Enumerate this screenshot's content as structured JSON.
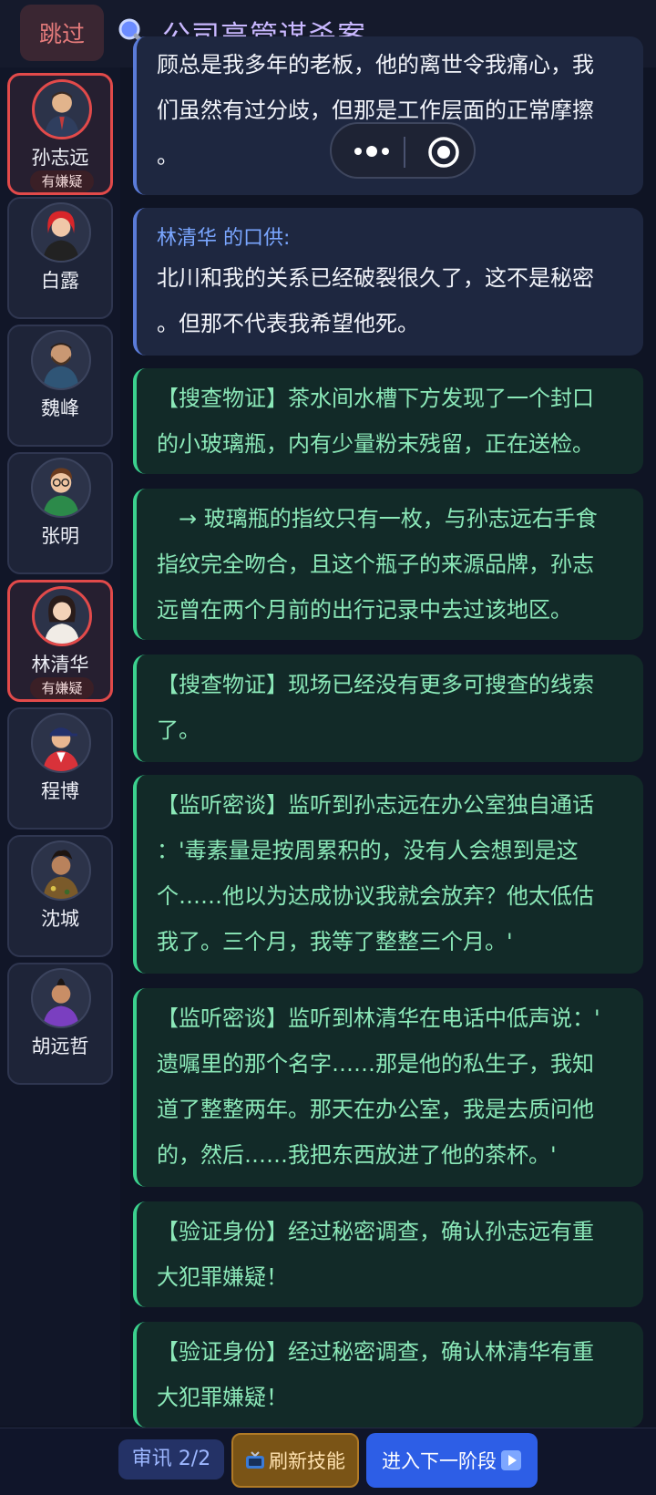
{
  "header": {
    "skip_label": "跳过",
    "title": "公司高管谋杀案"
  },
  "suspects": [
    {
      "name": "孙志远",
      "badge": "有嫌疑",
      "flagged": true
    },
    {
      "name": "白露",
      "badge": "",
      "flagged": false
    },
    {
      "name": "魏峰",
      "badge": "",
      "flagged": false
    },
    {
      "name": "张明",
      "badge": "",
      "flagged": false
    },
    {
      "name": "林清华",
      "badge": "有嫌疑",
      "flagged": true
    },
    {
      "name": "程博",
      "badge": "",
      "flagged": false
    },
    {
      "name": "沈城",
      "badge": "",
      "flagged": false
    },
    {
      "name": "胡远哲",
      "badge": "",
      "flagged": false
    }
  ],
  "messages": [
    {
      "type": "statement",
      "text": "顾总是我多年的老板，他的离世令我痛心，我\n们虽然有过分歧，但那是工作层面的正常摩擦\n。"
    },
    {
      "type": "statement",
      "speaker": "林清华 的口供:",
      "text": "北川和我的关系已经破裂很久了，这不是秘密\n。但那不代表我希望他死。"
    },
    {
      "type": "evidence",
      "text": "【搜查物证】茶水间水槽下方发现了一个封口\n的小玻璃瓶，内有少量粉末残留，正在送检。"
    },
    {
      "type": "evidence",
      "text": "　→ 玻璃瓶的指纹只有一枚，与孙志远右手食\n指纹完全吻合，且这个瓶子的来源品牌，孙志\n远曾在两个月前的出行记录中去过该地区。"
    },
    {
      "type": "evidence",
      "text": "【搜查物证】现场已经没有更多可搜查的线索\n了。"
    },
    {
      "type": "evidence",
      "text": "【监听密谈】监听到孙志远在办公室独自通话\n：'毒素量是按周累积的，没有人会想到是这\n个……他以为达成协议我就会放弃？他太低估\n我了。三个月，我等了整整三个月。'"
    },
    {
      "type": "evidence",
      "text": "【监听密谈】监听到林清华在电话中低声说：'\n遗嘱里的那个名字……那是他的私生子，我知\n道了整整两年。那天在办公室，我是去质问他\n的，然后……我把东西放进了他的茶杯。'"
    },
    {
      "type": "evidence",
      "text": "【验证身份】经过秘密调查，确认孙志远有重\n大犯罪嫌疑！"
    },
    {
      "type": "evidence",
      "text": "【验证身份】经过秘密调查，确认林清华有重\n大犯罪嫌疑！"
    }
  ],
  "bottom": {
    "round_label": "审讯 2/2",
    "skill_label": "刷新技能",
    "next_label": "进入下一阶段"
  },
  "colors": {
    "flag_border": "#e24a4a",
    "evidence_text": "#8be8b8",
    "statement_border": "#5a7bd8",
    "next_button": "#2d5ee6"
  }
}
